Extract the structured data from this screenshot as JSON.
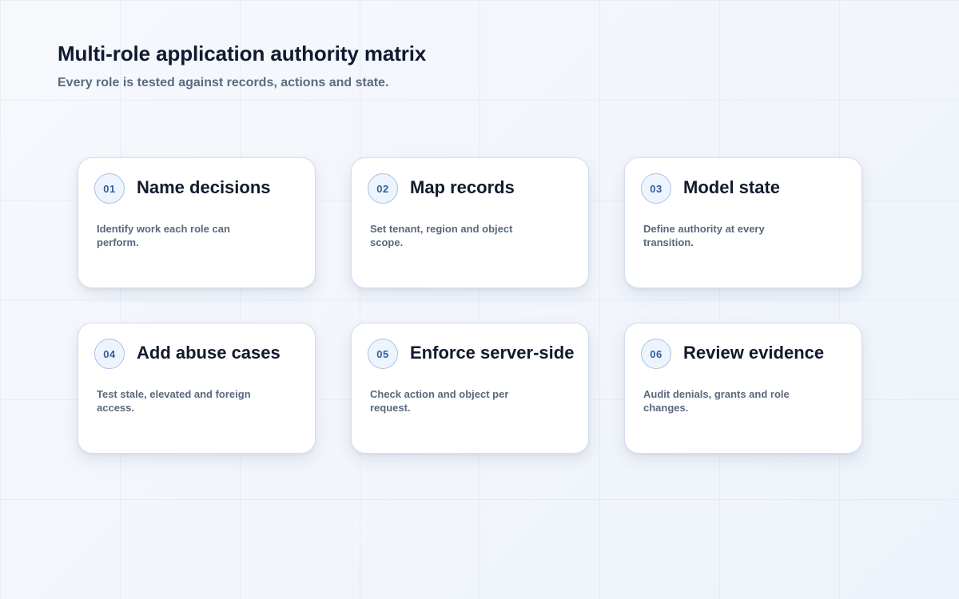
{
  "header": {
    "title": "Multi-role application authority matrix",
    "subtitle": "Every role is tested against records, actions and state."
  },
  "colors": {
    "background": "#f3f6fb",
    "card": "#ffffff",
    "accent": "#2f5f9e",
    "title_text": "#111a2e",
    "body_text": "#5a687d"
  },
  "steps": [
    {
      "number": "01",
      "title": "Name decisions",
      "description": "Identify work each role can perform."
    },
    {
      "number": "02",
      "title": "Map records",
      "description": "Set tenant, region and object scope."
    },
    {
      "number": "03",
      "title": "Model state",
      "description": "Define authority at every transition."
    },
    {
      "number": "04",
      "title": "Add abuse cases",
      "description": "Test stale, elevated and foreign access."
    },
    {
      "number": "05",
      "title": "Enforce server-side",
      "description": "Check action and object per request."
    },
    {
      "number": "06",
      "title": "Review evidence",
      "description": "Audit denials, grants and role changes."
    }
  ]
}
